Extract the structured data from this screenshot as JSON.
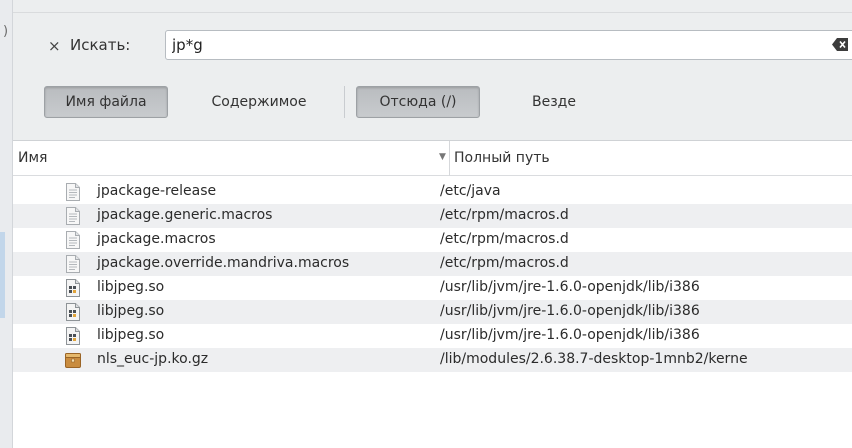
{
  "search": {
    "close_glyph": "×",
    "label": "Искать:",
    "value": "jp*g"
  },
  "buttons": {
    "filename": "Имя файла",
    "contents": "Содержимое",
    "here": "Отсюда (/)",
    "everywhere": "Везде"
  },
  "columns": {
    "name": "Имя",
    "sort_indicator": "▼",
    "path": "Полный путь"
  },
  "results": [
    {
      "name": "jpackage-release",
      "path": "/etc/java",
      "icon": "text-file-icon"
    },
    {
      "name": "jpackage.generic.macros",
      "path": "/etc/rpm/macros.d",
      "icon": "text-file-icon"
    },
    {
      "name": "jpackage.macros",
      "path": "/etc/rpm/macros.d",
      "icon": "text-file-icon"
    },
    {
      "name": "jpackage.override.mandriva.macros",
      "path": "/etc/rpm/macros.d",
      "icon": "text-file-icon"
    },
    {
      "name": "libjpeg.so",
      "path": "/usr/lib/jvm/jre-1.6.0-openjdk/lib/i386",
      "icon": "shared-library-icon"
    },
    {
      "name": "libjpeg.so",
      "path": "/usr/lib/jvm/jre-1.6.0-openjdk/lib/i386",
      "icon": "shared-library-icon"
    },
    {
      "name": "libjpeg.so",
      "path": "/usr/lib/jvm/jre-1.6.0-openjdk/lib/i386",
      "icon": "shared-library-icon"
    },
    {
      "name": "nls_euc-jp.ko.gz",
      "path": "/lib/modules/2.6.38.7-desktop-1mnb2/kerne",
      "icon": "archive-icon"
    }
  ],
  "left_strip_glyph": ")",
  "colors": {
    "toolbar_bg": "#eceeef",
    "row_alt": "#eeeff1",
    "pressed_btn": "#c0c3c6"
  }
}
